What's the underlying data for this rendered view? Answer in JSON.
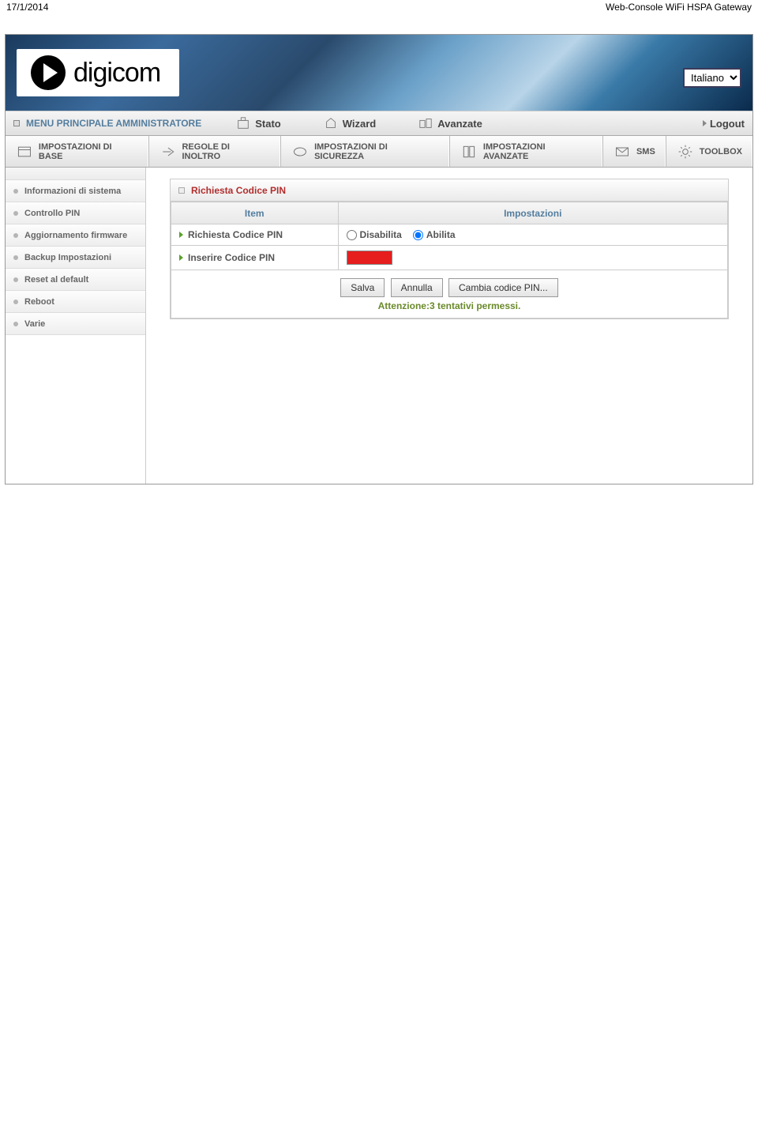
{
  "header": {
    "date": "17/1/2014",
    "page_title": "Web-Console WiFi HSPA Gateway"
  },
  "brand": {
    "name": "digicom"
  },
  "language": {
    "selected": "Italiano"
  },
  "topnav": {
    "main_label": "MENU PRINCIPALE AMMINISTRATORE",
    "items": [
      {
        "label": "Stato"
      },
      {
        "label": "Wizard"
      },
      {
        "label": "Avanzate"
      }
    ],
    "logout": "Logout"
  },
  "tabs": [
    {
      "label": "IMPOSTAZIONI DI BASE"
    },
    {
      "label": "REGOLE DI INOLTRO"
    },
    {
      "label": "IMPOSTAZIONI DI SICUREZZA"
    },
    {
      "label": "IMPOSTAZIONI AVANZATE"
    },
    {
      "label": "SMS"
    },
    {
      "label": "TOOLBOX"
    }
  ],
  "sidebar": {
    "items": [
      {
        "label": "Informazioni di sistema"
      },
      {
        "label": "Controllo PIN"
      },
      {
        "label": "Aggiornamento firmware"
      },
      {
        "label": "Backup Impostazioni"
      },
      {
        "label": "Reset al default"
      },
      {
        "label": "Reboot"
      },
      {
        "label": "Varie"
      }
    ]
  },
  "panel": {
    "title": "Richiesta Codice PIN",
    "col_item": "Item",
    "col_settings": "Impostazioni",
    "row1_label": "Richiesta Codice PIN",
    "radio_disable": "Disabilita",
    "radio_enable": "Abilita",
    "row2_label": "Inserire Codice PIN",
    "btn_save": "Salva",
    "btn_cancel": "Annulla",
    "btn_change": "Cambia codice PIN...",
    "warning": "Attenzione:3 tentativi permessi."
  }
}
